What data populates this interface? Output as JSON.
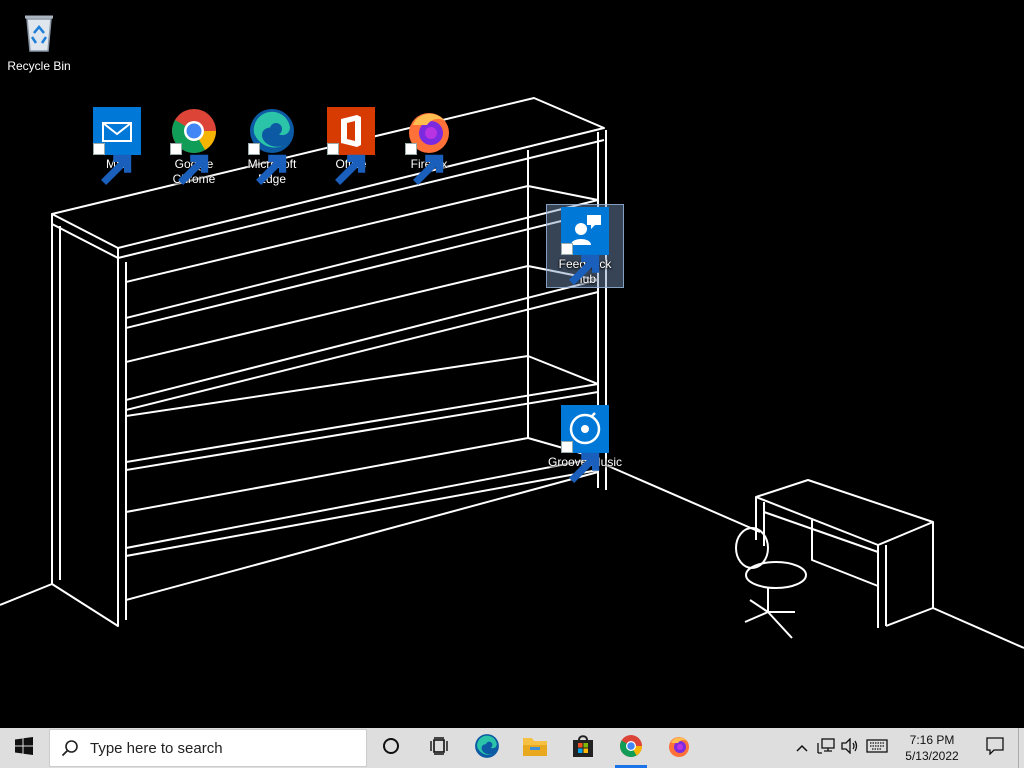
{
  "desktop": {
    "icons": [
      {
        "label": "Recycle Bin",
        "icon": "recycle-bin-icon"
      },
      {
        "label": "Mail",
        "icon": "mail-icon"
      },
      {
        "label": "Google Chrome",
        "icon": "chrome-icon"
      },
      {
        "label": "Microsoft Edge",
        "icon": "edge-icon"
      },
      {
        "label": "Office",
        "icon": "office-icon"
      },
      {
        "label": "Firefox",
        "icon": "firefox-icon"
      },
      {
        "label": "Feedback Hub",
        "icon": "feedback-hub-icon",
        "selected": true
      },
      {
        "label": "Groove Music",
        "icon": "groove-music-icon"
      }
    ]
  },
  "taskbar": {
    "search_placeholder": "Type here to search",
    "pinned": [
      "cortana-icon",
      "task-view-icon",
      "edge-icon",
      "file-explorer-icon",
      "store-icon",
      "chrome-icon",
      "firefox-icon"
    ],
    "running": [
      "chrome-icon"
    ],
    "clock": {
      "time": "7:16 PM",
      "date": "5/13/2022"
    }
  },
  "colors": {
    "taskbar": "#dedede",
    "accent": "#0078d7",
    "desktop": "#000000"
  }
}
